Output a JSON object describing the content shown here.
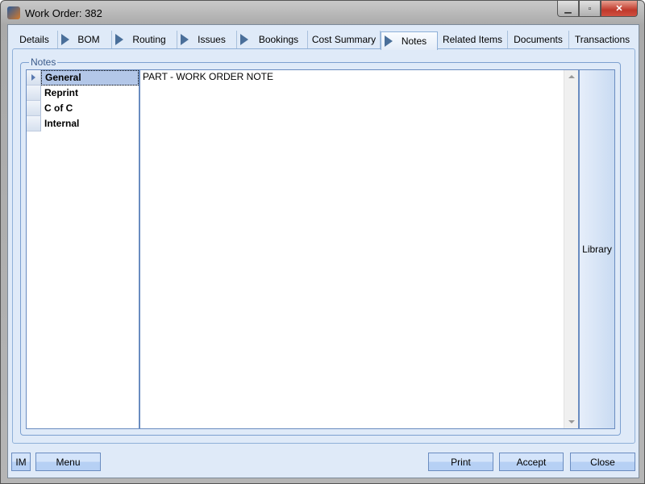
{
  "window": {
    "title": "Work Order: 382",
    "minimize": "▁",
    "maximize": "▫",
    "close": "✕"
  },
  "tabs": [
    {
      "label": "Details",
      "arrow": false
    },
    {
      "label": "BOM",
      "arrow": true
    },
    {
      "label": "Routing",
      "arrow": true
    },
    {
      "label": "Issues",
      "arrow": true
    },
    {
      "label": "Bookings",
      "arrow": true
    },
    {
      "label": "Cost Summary",
      "arrow": false
    },
    {
      "label": "Notes",
      "arrow": true,
      "selected": true
    },
    {
      "label": "Related Items",
      "arrow": false
    },
    {
      "label": "Documents",
      "arrow": false
    },
    {
      "label": "Transactions",
      "arrow": false
    }
  ],
  "notes": {
    "group_label": "Notes",
    "categories": [
      "General",
      "Reprint",
      "C of C",
      "Internal"
    ],
    "selected_category": "General",
    "text": "PART - WORK ORDER NOTE",
    "library_label": "Library"
  },
  "footer": {
    "im": "IM",
    "menu": "Menu",
    "print": "Print",
    "accept": "Accept",
    "close": "Close"
  }
}
